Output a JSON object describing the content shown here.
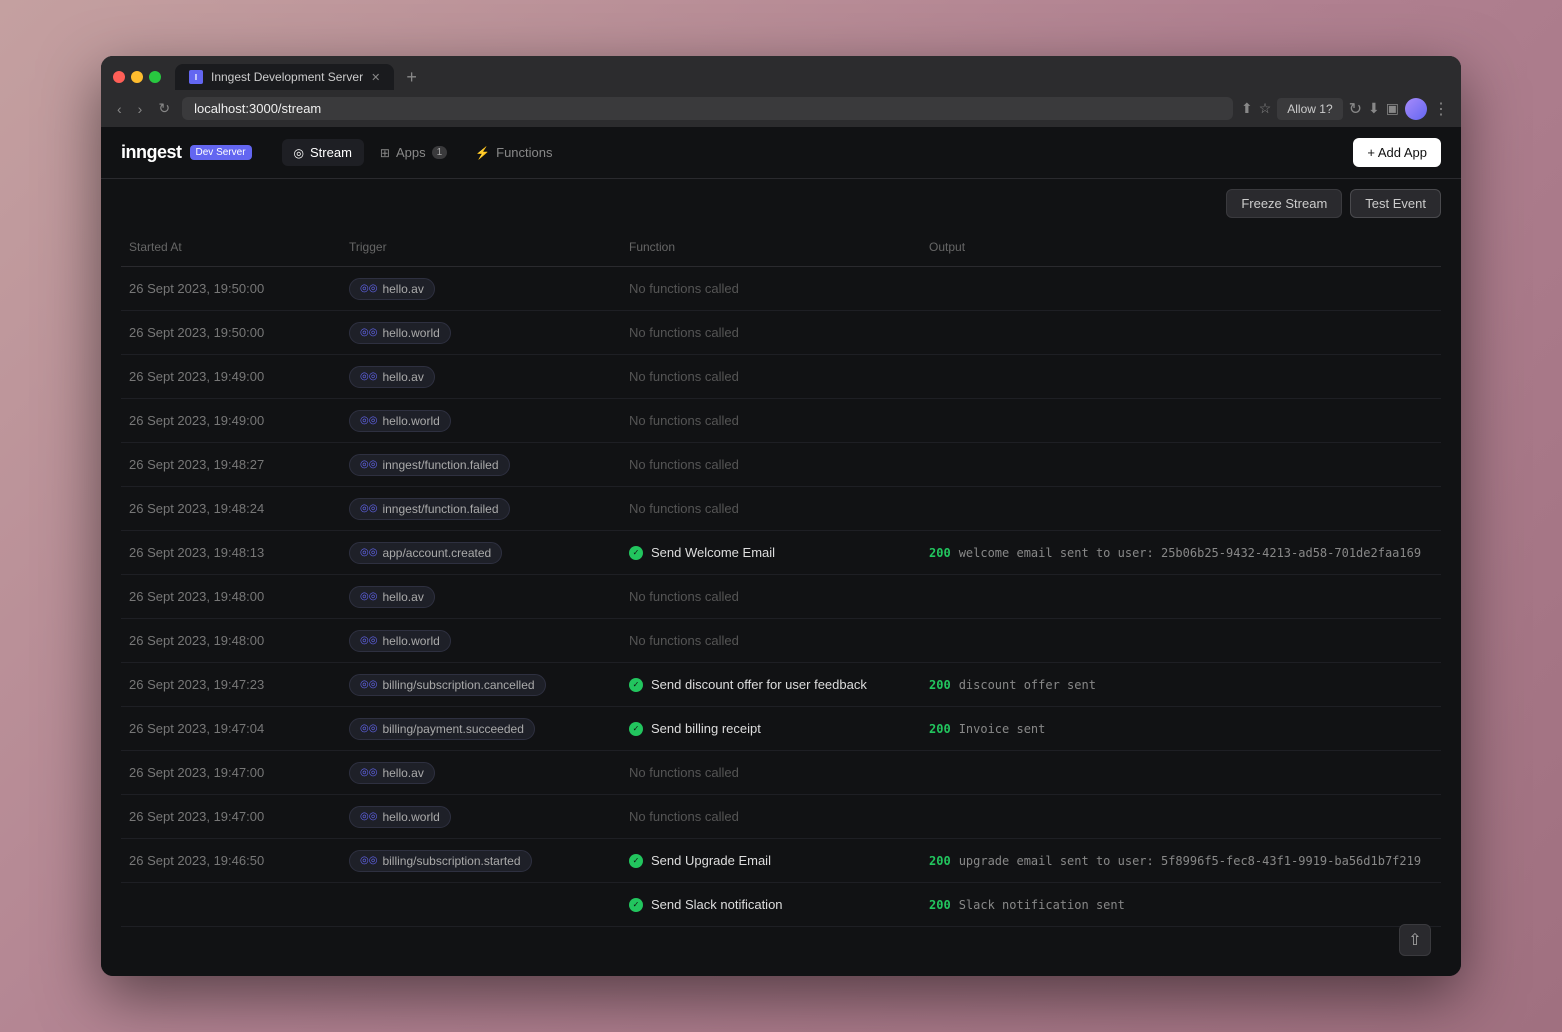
{
  "browser": {
    "tab_title": "Inngest Development Server",
    "url": "localhost:3000/stream",
    "allow_label": "Allow 1?",
    "new_tab_label": "+"
  },
  "app": {
    "logo": "inngest",
    "badge": "Dev Server",
    "add_app_label": "+ Add App"
  },
  "nav": {
    "items": [
      {
        "id": "stream",
        "icon": "◎",
        "label": "Stream",
        "active": true
      },
      {
        "id": "apps",
        "icon": "⊞",
        "label": "Apps",
        "badge": "1",
        "active": false
      },
      {
        "id": "functions",
        "icon": "⚡",
        "label": "Functions",
        "active": false
      }
    ]
  },
  "toolbar": {
    "freeze_label": "Freeze Stream",
    "test_label": "Test Event"
  },
  "table": {
    "headers": [
      "Started At",
      "Trigger",
      "Function",
      "Output"
    ],
    "rows": [
      {
        "started_at": "26 Sept 2023, 19:50:00",
        "trigger": "hello.av",
        "function": null,
        "function_label": "No functions called",
        "output": "",
        "has_output": false
      },
      {
        "started_at": "26 Sept 2023, 19:50:00",
        "trigger": "hello.world",
        "function": null,
        "function_label": "No functions called",
        "output": "",
        "has_output": false
      },
      {
        "started_at": "26 Sept 2023, 19:49:00",
        "trigger": "hello.av",
        "function": null,
        "function_label": "No functions called",
        "output": "",
        "has_output": false
      },
      {
        "started_at": "26 Sept 2023, 19:49:00",
        "trigger": "hello.world",
        "function": null,
        "function_label": "No functions called",
        "output": "",
        "has_output": false
      },
      {
        "started_at": "26 Sept 2023, 19:48:27",
        "trigger": "inngest/function.failed",
        "function": null,
        "function_label": "No functions called",
        "output": "",
        "has_output": false
      },
      {
        "started_at": "26 Sept 2023, 19:48:24",
        "trigger": "inngest/function.failed",
        "function": null,
        "function_label": "No functions called",
        "output": "",
        "has_output": false
      },
      {
        "started_at": "26 Sept 2023, 19:48:13",
        "trigger": "app/account.created",
        "function": "Send Welcome Email",
        "function_label": "Send Welcome Email",
        "output_status": "200",
        "output": "welcome email sent to user: 25b06b25-9432-4213-ad58-701de2faa169",
        "has_output": true
      },
      {
        "started_at": "26 Sept 2023, 19:48:00",
        "trigger": "hello.av",
        "function": null,
        "function_label": "No functions called",
        "output": "",
        "has_output": false
      },
      {
        "started_at": "26 Sept 2023, 19:48:00",
        "trigger": "hello.world",
        "function": null,
        "function_label": "No functions called",
        "output": "",
        "has_output": false
      },
      {
        "started_at": "26 Sept 2023, 19:47:23",
        "trigger": "billing/subscription.cancelled",
        "function": "Send discount offer for user feedback",
        "function_label": "Send discount offer for user feedback",
        "output_status": "200",
        "output": "discount offer sent",
        "has_output": true
      },
      {
        "started_at": "26 Sept 2023, 19:47:04",
        "trigger": "billing/payment.succeeded",
        "function": "Send billing receipt",
        "function_label": "Send billing receipt",
        "output_status": "200",
        "output": "Invoice sent",
        "has_output": true
      },
      {
        "started_at": "26 Sept 2023, 19:47:00",
        "trigger": "hello.av",
        "function": null,
        "function_label": "No functions called",
        "output": "",
        "has_output": false
      },
      {
        "started_at": "26 Sept 2023, 19:47:00",
        "trigger": "hello.world",
        "function": null,
        "function_label": "No functions called",
        "output": "",
        "has_output": false
      },
      {
        "started_at": "26 Sept 2023, 19:46:50",
        "trigger": "billing/subscription.started",
        "function": "Send Upgrade Email",
        "function_label": "Send Upgrade Email",
        "output_status": "200",
        "output": "upgrade email sent to user: 5f8996f5-fec8-43f1-9919-ba56d1b7f219",
        "has_output": true
      },
      {
        "started_at": "",
        "trigger": "",
        "function": "Send Slack notification",
        "function_label": "Send Slack notification",
        "output_status": "200",
        "output": "Slack notification sent",
        "has_output": true,
        "is_continuation": true
      }
    ]
  },
  "colors": {
    "success": "#22c55e",
    "accent": "#6366f1",
    "bg_dark": "#111214",
    "text_muted": "#666"
  }
}
